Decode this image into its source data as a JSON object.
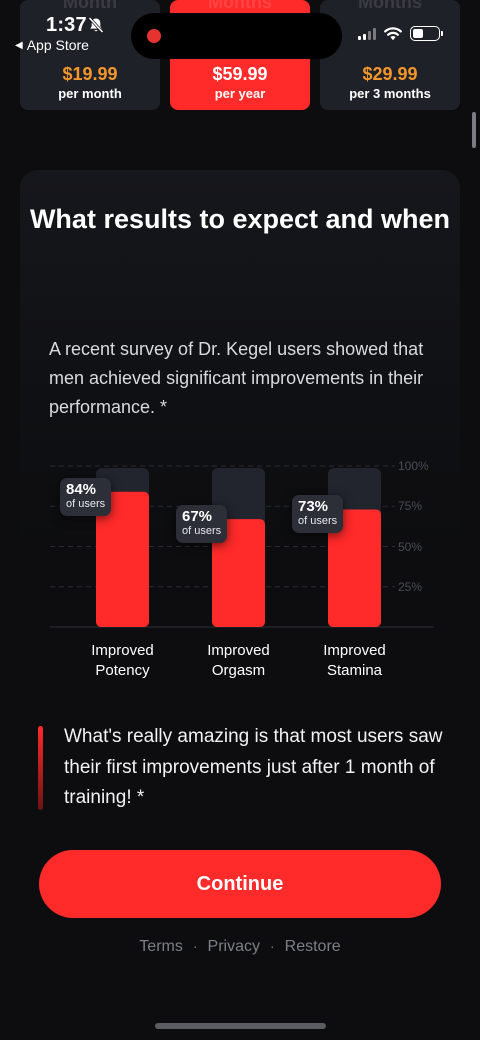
{
  "status_bar": {
    "time": "1:37",
    "back_label": "App Store"
  },
  "plans": [
    {
      "ghost": "Month",
      "price": "$19.99",
      "period": "per month",
      "selected": false
    },
    {
      "ghost": "Months",
      "price": "$59.99",
      "period": "per year",
      "selected": true
    },
    {
      "ghost": "Months",
      "price": "$29.99",
      "period": "per 3 months",
      "selected": false
    }
  ],
  "card": {
    "title": "What results to expect and when",
    "intro": "A recent survey of Dr. Kegel users showed that men achieved significant improvements in their performance. *"
  },
  "chart_data": {
    "type": "bar",
    "categories": [
      "Improved Potency",
      "Improved Orgasm",
      "Improved Stamina"
    ],
    "values": [
      84,
      67,
      73
    ],
    "value_labels": [
      "84%",
      "67%",
      "73%"
    ],
    "sub_label": "of users",
    "ylim": [
      0,
      100
    ],
    "y_ticks": [
      "100%",
      "75%",
      "50%",
      "25%"
    ],
    "grid": true,
    "colors": {
      "bar": "#ff2a2a",
      "track": "#22252d"
    }
  },
  "quote": {
    "text": "What's really amazing is that most users saw their first improvements just after 1 month of training! *"
  },
  "cta": {
    "label": "Continue"
  },
  "links": [
    "Terms",
    "Privacy",
    "Restore"
  ],
  "colors": {
    "accent": "#ff2a2a",
    "price": "#f3962b",
    "background": "#0d0d0f"
  }
}
